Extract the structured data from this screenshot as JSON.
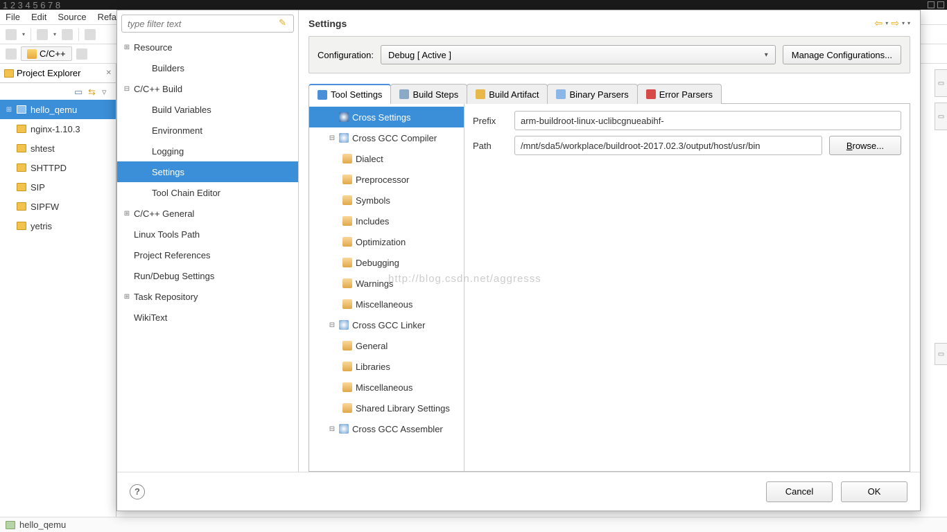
{
  "desktop": {
    "workspaces": "1  2  3  4  5  6  7  8"
  },
  "menubar": {
    "file": "File",
    "edit": "Edit",
    "source": "Source",
    "refactor": "Refa"
  },
  "perspective": {
    "label": "C/C++"
  },
  "explorer": {
    "title": "Project Explorer",
    "items": [
      {
        "name": "hello_qemu",
        "selected": true,
        "expandable": true
      },
      {
        "name": "nginx-1.10.3"
      },
      {
        "name": "shtest"
      },
      {
        "name": "SHTTPD"
      },
      {
        "name": "SIP"
      },
      {
        "name": "SIPFW"
      },
      {
        "name": "yetris"
      }
    ]
  },
  "dialog": {
    "filter_placeholder": "type filter text",
    "pref_tree": [
      {
        "label": "Resource",
        "expandable": true
      },
      {
        "label": "Builders",
        "level": 1
      },
      {
        "label": "C/C++ Build",
        "expandable": true,
        "expanded": true
      },
      {
        "label": "Build Variables",
        "level": 1
      },
      {
        "label": "Environment",
        "level": 1
      },
      {
        "label": "Logging",
        "level": 1
      },
      {
        "label": "Settings",
        "level": 1,
        "selected": true
      },
      {
        "label": "Tool Chain Editor",
        "level": 1
      },
      {
        "label": "C/C++ General",
        "expandable": true
      },
      {
        "label": "Linux Tools Path"
      },
      {
        "label": "Project References"
      },
      {
        "label": "Run/Debug Settings"
      },
      {
        "label": "Task Repository",
        "expandable": true
      },
      {
        "label": "WikiText"
      }
    ],
    "title": "Settings",
    "config_label": "Configuration:",
    "config_value": "Debug  [ Active ]",
    "manage_btn": "Manage Configurations...",
    "tabs": [
      {
        "label": "Tool Settings",
        "active": true,
        "icon": "ic-tool"
      },
      {
        "label": "Build Steps",
        "icon": "ic-steps"
      },
      {
        "label": "Build Artifact",
        "icon": "ic-artifact"
      },
      {
        "label": "Binary Parsers",
        "icon": "ic-binary"
      },
      {
        "label": "Error Parsers",
        "icon": "ic-error"
      }
    ],
    "tool_tree": [
      {
        "label": "Cross Settings",
        "lv": 1,
        "icon": "tic-gear",
        "selected": true
      },
      {
        "label": "Cross GCC Compiler",
        "lv": 1,
        "icon": "tic-gear",
        "exp": "⊟"
      },
      {
        "label": "Dialect",
        "lv": 2,
        "icon": "tic-folder"
      },
      {
        "label": "Preprocessor",
        "lv": 2,
        "icon": "tic-folder"
      },
      {
        "label": "Symbols",
        "lv": 2,
        "icon": "tic-folder"
      },
      {
        "label": "Includes",
        "lv": 2,
        "icon": "tic-folder"
      },
      {
        "label": "Optimization",
        "lv": 2,
        "icon": "tic-folder"
      },
      {
        "label": "Debugging",
        "lv": 2,
        "icon": "tic-folder"
      },
      {
        "label": "Warnings",
        "lv": 2,
        "icon": "tic-folder"
      },
      {
        "label": "Miscellaneous",
        "lv": 2,
        "icon": "tic-folder"
      },
      {
        "label": "Cross GCC Linker",
        "lv": 1,
        "icon": "tic-gear",
        "exp": "⊟"
      },
      {
        "label": "General",
        "lv": 2,
        "icon": "tic-folder"
      },
      {
        "label": "Libraries",
        "lv": 2,
        "icon": "tic-folder"
      },
      {
        "label": "Miscellaneous",
        "lv": 2,
        "icon": "tic-folder"
      },
      {
        "label": "Shared Library Settings",
        "lv": 2,
        "icon": "tic-folder"
      },
      {
        "label": "Cross GCC Assembler",
        "lv": 1,
        "icon": "tic-gear",
        "exp": "⊟"
      }
    ],
    "form": {
      "prefix_label": "Prefix",
      "prefix_value": "arm-buildroot-linux-uclibcgnueabihf-",
      "path_label": "Path",
      "path_value": "/mnt/sda5/workplace/buildroot-2017.02.3/output/host/usr/bin",
      "browse": "Browse..."
    },
    "footer": {
      "cancel": "Cancel",
      "ok": "OK"
    }
  },
  "statusbar": {
    "text": "hello_qemu"
  },
  "watermark": "http://blog.csdn.net/aggresss"
}
